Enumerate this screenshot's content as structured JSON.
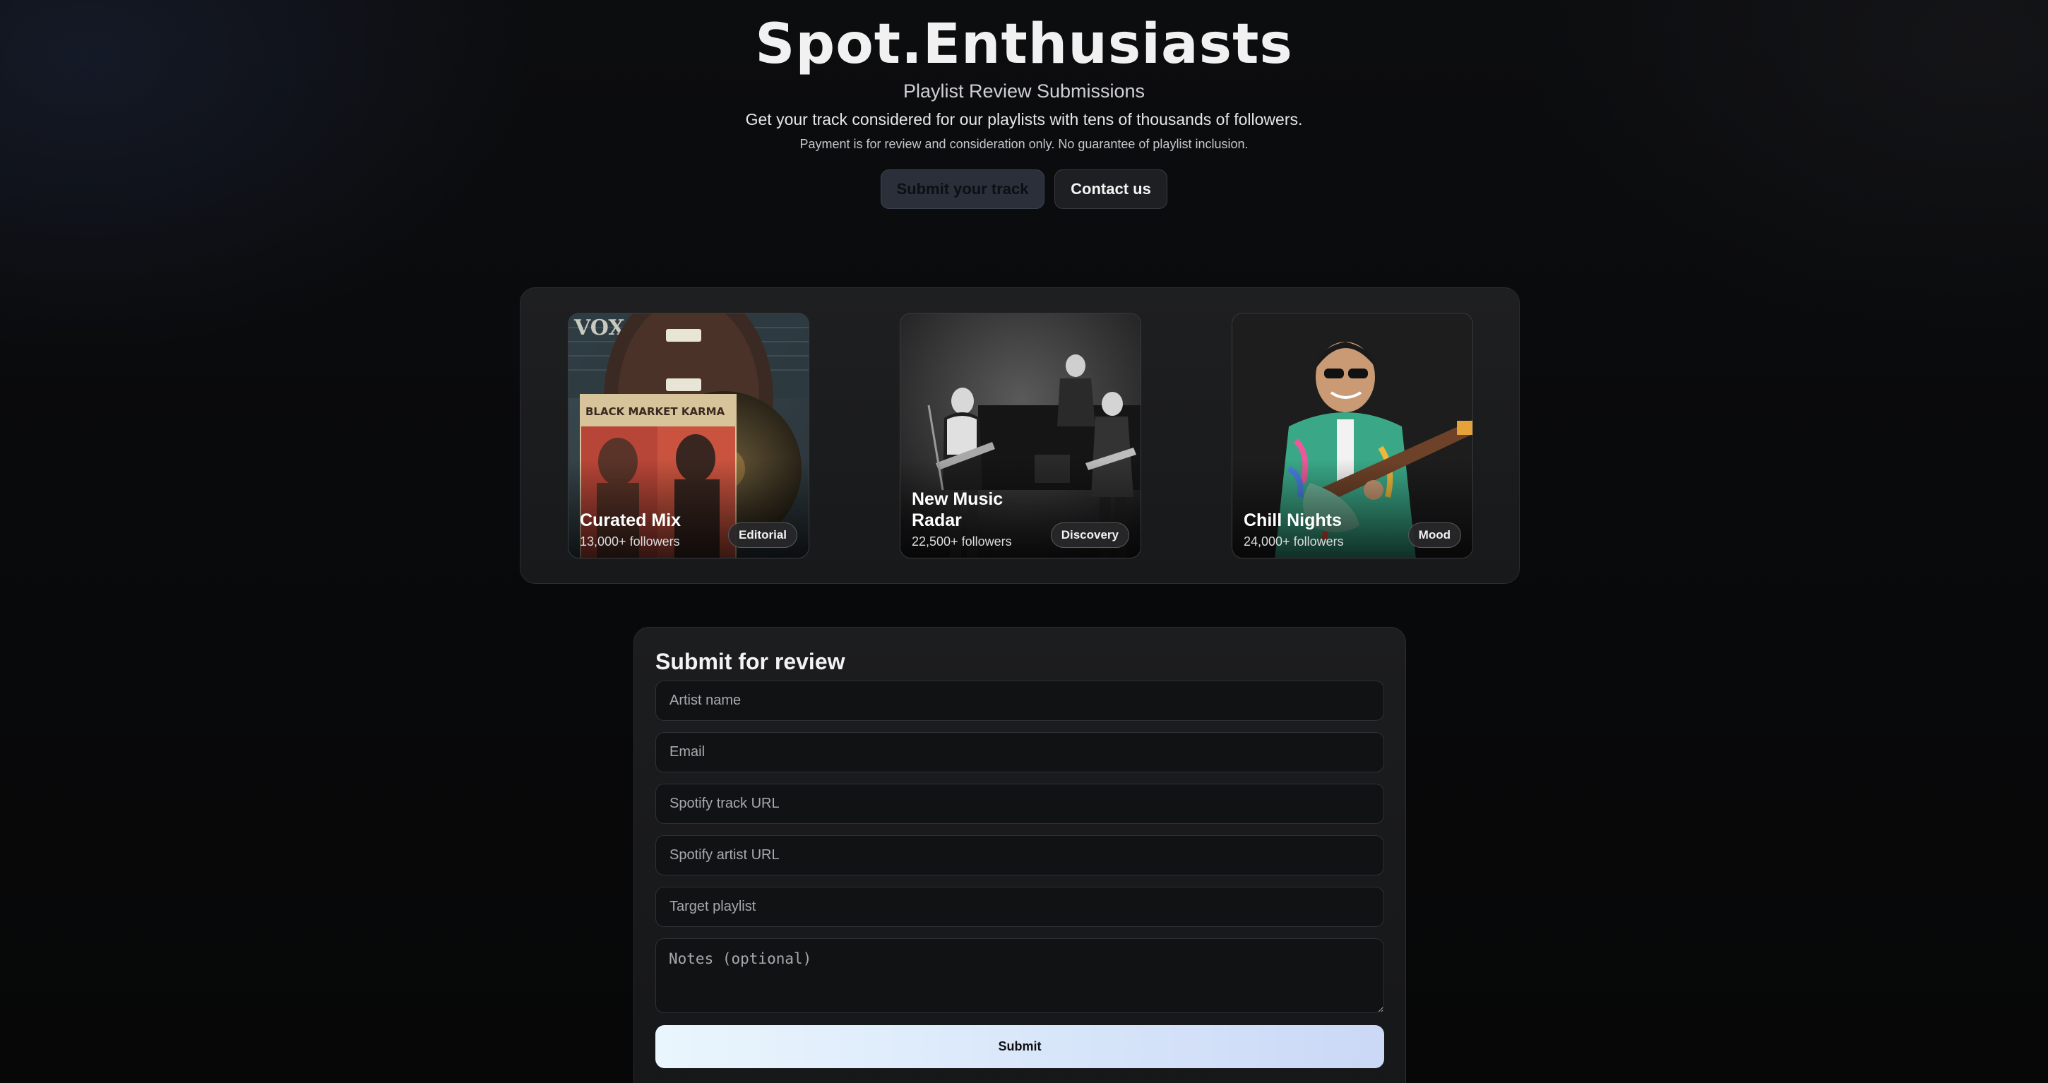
{
  "header": {
    "title": "Spot.Enthusiasts",
    "subtitle": "Playlist Review Submissions",
    "tagline": "Get your track considered for our playlists with tens of thousands of followers.",
    "disclaimer": "Payment is for review and consideration only. No guarantee of playlist inclusion.",
    "primary_button": "Submit your track",
    "secondary_button": "Contact us"
  },
  "playlists": [
    {
      "name": "Curated Mix",
      "followers": "13,000+ followers",
      "badge": "Editorial"
    },
    {
      "name": "New Music Radar",
      "followers": "22,500+ followers",
      "badge": "Discovery"
    },
    {
      "name": "Chill Nights",
      "followers": "24,000+ followers",
      "badge": "Mood"
    }
  ],
  "card_art_text": "VOX",
  "poster_text": "BLACK MARKET KARMA",
  "form": {
    "title": "Submit for review",
    "artist_name_placeholder": "Artist name",
    "email_placeholder": "Email",
    "track_url_placeholder": "Spotify track URL",
    "artist_url_placeholder": "Spotify artist URL",
    "target_playlist_placeholder": "Target playlist",
    "notes_placeholder": "Notes (optional)",
    "submit_label": "Submit"
  },
  "colors": {
    "background": "#08090a",
    "panel": "#1c1d1f",
    "submit_gradient_start": "#eaf6fd",
    "submit_gradient_end": "#cbd8f6"
  }
}
